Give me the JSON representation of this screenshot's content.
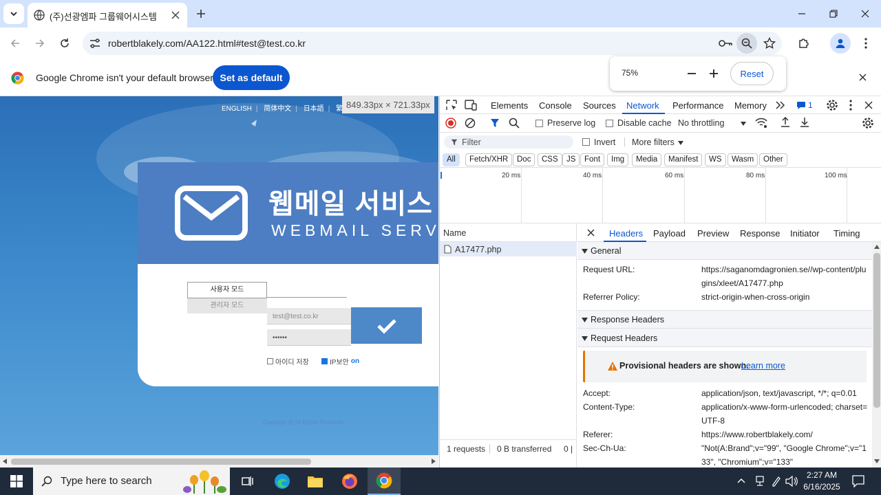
{
  "browser": {
    "tab_title": "(주)선광엠파 그룹웨어시스템",
    "url": "robertblakely.com/AA122.html#test@test.co.kr",
    "infobar_text": "Google Chrome isn't your default browser",
    "set_default_label": "Set as default",
    "zoom": {
      "level": "75%",
      "minus": "−",
      "plus": "+",
      "reset_label": "Reset"
    }
  },
  "page": {
    "languages": [
      "ENGLISH",
      "简体中文",
      "日本語",
      "繁"
    ],
    "size_tooltip": "849.33px × 721.33px",
    "banner_ko": "웹메일 서비스",
    "banner_en": "WEBMAIL SERVICE",
    "tab_user": "사용자 모드",
    "tab_admin": "관리자 모드",
    "email_value": "test@test.co.kr",
    "password_value": "••••••",
    "save_id_label": "아이디 저장",
    "ip_security_label": "IP보안",
    "ip_security_state": "on",
    "copyright": "Copyright @ All Rights Reserved."
  },
  "devtools": {
    "tabs": [
      "Elements",
      "Console",
      "Sources",
      "Network",
      "Performance",
      "Memory"
    ],
    "active_tab": "Network",
    "issues_count": "1",
    "toolbar": {
      "preserve_log": "Preserve log",
      "disable_cache": "Disable cache",
      "throttling": "No throttling"
    },
    "filter": {
      "placeholder": "Filter",
      "invert": "Invert",
      "more_filters": "More filters"
    },
    "type_chips": [
      "All",
      "Fetch/XHR",
      "Doc",
      "CSS",
      "JS",
      "Font",
      "Img",
      "Media",
      "Manifest",
      "WS",
      "Wasm",
      "Other"
    ],
    "timeline_ticks": [
      "20 ms",
      "40 ms",
      "60 ms",
      "80 ms",
      "100 ms"
    ],
    "name_column": "Name",
    "request_name": "A17477.php",
    "status": {
      "requests": "1 requests",
      "transferred": "0 B transferred",
      "extra": "0 |"
    },
    "detail_tabs": [
      "Headers",
      "Payload",
      "Preview",
      "Response",
      "Initiator",
      "Timing"
    ],
    "general": {
      "title": "General",
      "request_url_key": "Request URL:",
      "request_url_val": "https://saganomdagronien.se//wp-content/plugins/xleet/A17477.php",
      "referrer_policy_key": "Referrer Policy:",
      "referrer_policy_val": "strict-origin-when-cross-origin"
    },
    "response_headers_title": "Response Headers",
    "request_headers": {
      "title": "Request Headers",
      "warning": "Provisional headers are shown.",
      "learn_more": "Learn more",
      "accept_key": "Accept:",
      "accept_val": "application/json, text/javascript, */*; q=0.01",
      "content_type_key": "Content-Type:",
      "content_type_val": "application/x-www-form-urlencoded; charset=UTF-8",
      "referer_key": "Referer:",
      "referer_val": "https://www.robertblakely.com/",
      "sec_ch_ua_key": "Sec-Ch-Ua:",
      "sec_ch_ua_val": "\"Not(A:Brand\";v=\"99\", \"Google Chrome\";v=\"133\", \"Chromium\";v=\"133\""
    }
  },
  "taskbar": {
    "search_placeholder": "Type here to search",
    "time": "2:27 AM",
    "date": "6/16/2025"
  },
  "colors": {
    "chrome_blue": "#0b57d0",
    "tabstrip": "#d3e3fd",
    "page_banner": "#4d7ec3",
    "taskbar": "#1f2a3a"
  }
}
